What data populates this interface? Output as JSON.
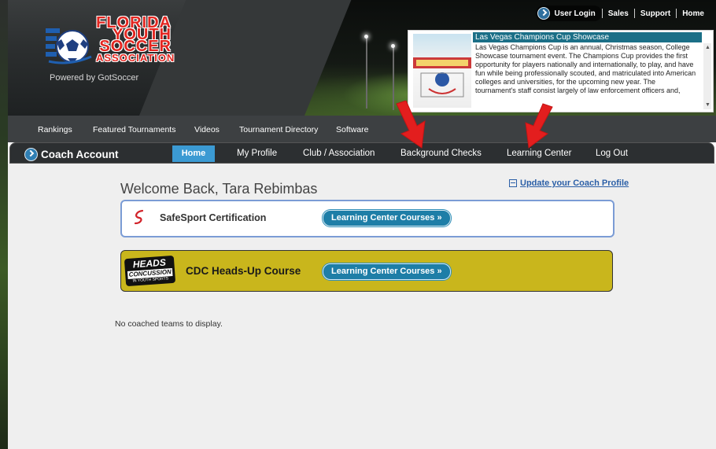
{
  "logo": {
    "lines": [
      "FLORIDA",
      "YOUTH",
      "SOCCER",
      "ASSOCIATION"
    ],
    "powered_by": "Powered by GotSoccer"
  },
  "topbar": {
    "user_login": "User Login",
    "sales": "Sales",
    "support": "Support",
    "home": "Home"
  },
  "news": {
    "title": "Las Vegas Champions Cup Showcase",
    "body": "Las Vegas Champions Cup is an annual, Christmas season, College Showcase tournament event. The Champions Cup provides the first opportunity for players nationally and internationally, to play, and have fun while being professionally scouted, and matriculated into American colleges and universities, for the upcoming new year. The tournament's staff consist largely of law enforcement officers and,"
  },
  "main_nav": [
    "Rankings",
    "Featured Tournaments",
    "Videos",
    "Tournament Directory",
    "Software"
  ],
  "coach_nav": {
    "title": "Coach Account",
    "items": [
      "Home",
      "My Profile",
      "Club / Association",
      "Background Checks",
      "Learning Center",
      "Log Out"
    ],
    "active": "Home"
  },
  "content": {
    "welcome": "Welcome Back, Tara Rebimbas",
    "update_profile": "Update your Coach Profile",
    "cards": [
      {
        "label": "SafeSport Certification",
        "button": "Learning Center Courses »"
      },
      {
        "label": "CDC Heads-Up Course",
        "button": "Learning Center Courses »"
      }
    ],
    "heads_up_badge": {
      "top": "HEADS UP",
      "middle": "CONCUSSION",
      "bottom": "IN YOUTH SPORTS"
    },
    "no_teams": "No coached teams to display."
  },
  "colors": {
    "nav_active": "#3b9ad3",
    "course_button": "#1e7ea7",
    "cdc_card": "#c9b61c",
    "safesport_border": "#7b9cd5",
    "arrow": "#e31e1e"
  }
}
